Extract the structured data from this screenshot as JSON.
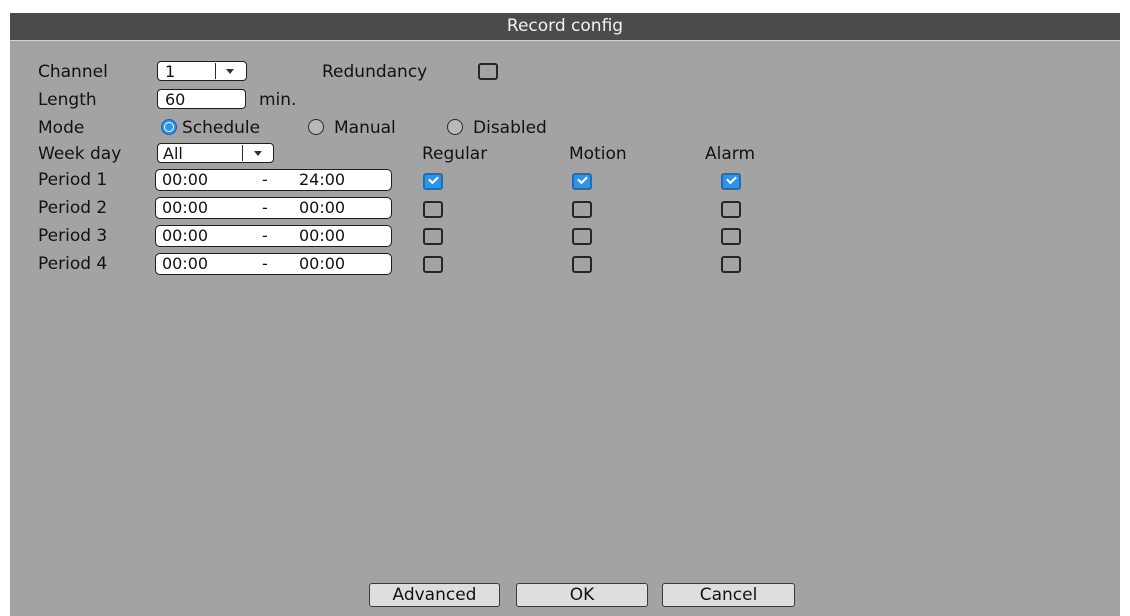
{
  "dialog": {
    "title": "Record config"
  },
  "channel": {
    "label": "Channel",
    "value": "1"
  },
  "redundancy": {
    "label": "Redundancy",
    "checked": false
  },
  "length": {
    "label": "Length",
    "value": "60",
    "unit": "min."
  },
  "mode": {
    "label": "Mode",
    "options": [
      "Schedule",
      "Manual",
      "Disabled"
    ],
    "selected": "Schedule"
  },
  "weekday": {
    "label": "Week day",
    "value": "All"
  },
  "columns": [
    "Regular",
    "Motion",
    "Alarm"
  ],
  "periods": [
    {
      "label": "Period 1",
      "start": "00:00",
      "sep": "-",
      "end": "24:00",
      "regular": true,
      "motion": true,
      "alarm": true
    },
    {
      "label": "Period 2",
      "start": "00:00",
      "sep": "-",
      "end": "00:00",
      "regular": false,
      "motion": false,
      "alarm": false
    },
    {
      "label": "Period 3",
      "start": "00:00",
      "sep": "-",
      "end": "00:00",
      "regular": false,
      "motion": false,
      "alarm": false
    },
    {
      "label": "Period 4",
      "start": "00:00",
      "sep": "-",
      "end": "00:00",
      "regular": false,
      "motion": false,
      "alarm": false
    }
  ],
  "buttons": {
    "advanced": "Advanced",
    "ok": "OK",
    "cancel": "Cancel"
  },
  "icons": {
    "dropdown": "chevron-down-icon",
    "checkbox": "checkbox-icon",
    "radio": "radio-icon"
  },
  "colors": {
    "window_bg": "#a3a3a3",
    "titlebar_bg": "#4b4b4b",
    "accent": "#2f93e6"
  }
}
